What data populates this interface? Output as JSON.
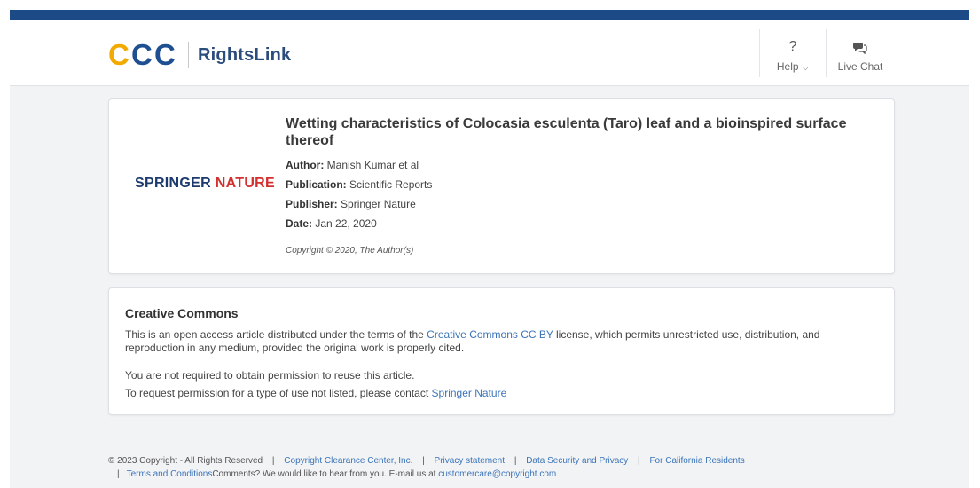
{
  "header": {
    "logo_text": "CCC",
    "product_name": "RightsLink",
    "help_label": "Help",
    "live_chat_label": "Live Chat",
    "help_icon": "question-mark-icon",
    "chat_icon": "chat-bubbles-icon"
  },
  "article": {
    "publisher_logo": {
      "part1": "SPRINGER",
      "part2": "NATURE"
    },
    "title": "Wetting characteristics of Colocasia esculenta (Taro) leaf and a bioinspired surface thereof",
    "author_label": "Author:",
    "author": "Manish Kumar et al",
    "publication_label": "Publication:",
    "publication": "Scientific Reports",
    "publisher_label": "Publisher:",
    "publisher": "Springer Nature",
    "date_label": "Date:",
    "date": "Jan 22, 2020",
    "copyright": "Copyright © 2020, The Author(s)"
  },
  "cc": {
    "title": "Creative Commons",
    "para_before": "This is an open access article distributed under the terms of the ",
    "license_link": "Creative Commons CC BY",
    "para_after": " license, which permits unrestricted use, distribution, and reproduction in any medium, provided the original work is properly cited.",
    "line2": "You are not required to obtain permission to reuse this article.",
    "line3_before": "To request permission for a type of use not listed, please contact ",
    "contact_link": "Springer Nature"
  },
  "footer": {
    "copyright": "© 2023 Copyright - All Rights Reserved",
    "sep": "|",
    "link_ccc": "Copyright Clearance Center, Inc.",
    "link_privacy": "Privacy statement",
    "link_data": "Data Security and Privacy",
    "link_california": "For California Residents",
    "link_terms": "Terms and Conditions",
    "comments": "Comments? We would like to hear from you. E-mail us at ",
    "email": "customercare@copyright.com"
  },
  "colors": {
    "top_bar": "#1c4a86",
    "link": "#3b74b8",
    "ccc_yellow": "#f2a900",
    "ccc_blue": "#1d4f91",
    "springer_red": "#d32f2f"
  }
}
